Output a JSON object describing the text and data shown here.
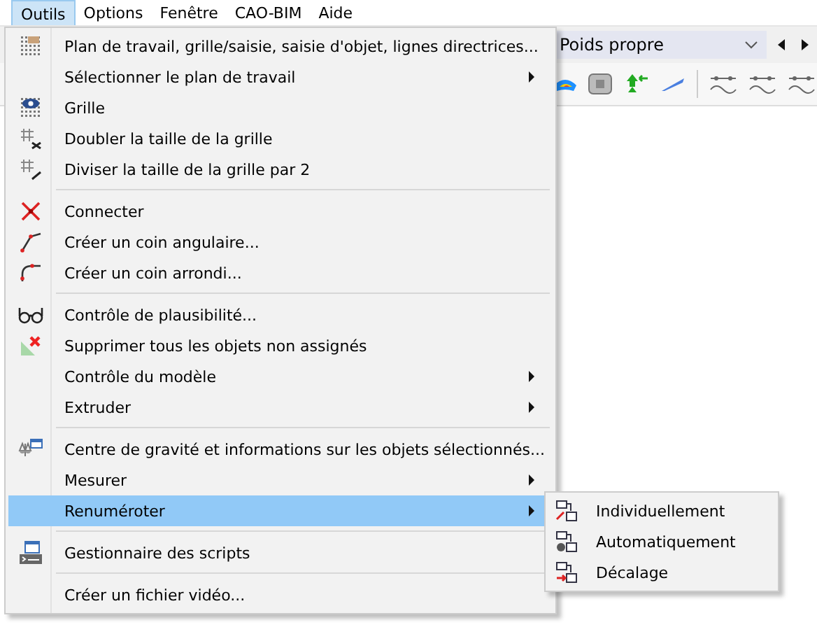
{
  "menubar": [
    {
      "label": "Outils",
      "selected": true
    },
    {
      "label": "Options",
      "selected": false
    },
    {
      "label": "Fenêtre",
      "selected": false
    },
    {
      "label": "CAO-BIM",
      "selected": false
    },
    {
      "label": "Aide",
      "selected": false
    }
  ],
  "load_case": {
    "value": "Poids propre"
  },
  "menu": {
    "items": [
      {
        "kind": "item",
        "label": "Plan de travail, grille/saisie, saisie d'objet, lignes directrices...",
        "submenu": false,
        "selected": false
      },
      {
        "kind": "item",
        "label": "Sélectionner le plan de travail",
        "submenu": true,
        "selected": false
      },
      {
        "kind": "item",
        "label": "Grille",
        "submenu": false,
        "selected": false
      },
      {
        "kind": "item",
        "label": "Doubler la taille de la grille",
        "submenu": false,
        "selected": false
      },
      {
        "kind": "item",
        "label": "Diviser la taille de la grille par 2",
        "submenu": false,
        "selected": false
      },
      {
        "kind": "separator"
      },
      {
        "kind": "item",
        "label": "Connecter",
        "submenu": false,
        "selected": false
      },
      {
        "kind": "item",
        "label": "Créer un coin angulaire...",
        "submenu": false,
        "selected": false
      },
      {
        "kind": "item",
        "label": "Créer un coin arrondi...",
        "submenu": false,
        "selected": false
      },
      {
        "kind": "separator"
      },
      {
        "kind": "item",
        "label": "Contrôle de plausibilité...",
        "submenu": false,
        "selected": false
      },
      {
        "kind": "item",
        "label": "Supprimer tous les objets non assignés",
        "submenu": false,
        "selected": false
      },
      {
        "kind": "item",
        "label": "Contrôle du modèle",
        "submenu": true,
        "selected": false
      },
      {
        "kind": "item",
        "label": "Extruder",
        "submenu": true,
        "selected": false
      },
      {
        "kind": "separator"
      },
      {
        "kind": "item",
        "label": "Centre de gravité et informations sur les objets sélectionnés...",
        "submenu": false,
        "selected": false
      },
      {
        "kind": "item",
        "label": "Mesurer",
        "submenu": true,
        "selected": false
      },
      {
        "kind": "item",
        "label": "Renuméroter",
        "submenu": true,
        "selected": true
      },
      {
        "kind": "separator"
      },
      {
        "kind": "item",
        "label": "Gestionnaire des scripts",
        "submenu": false,
        "selected": false
      },
      {
        "kind": "separator"
      },
      {
        "kind": "item",
        "label": "Créer un fichier vidéo...",
        "submenu": false,
        "selected": false
      }
    ]
  },
  "submenu": {
    "items": [
      {
        "label": "Individuellement"
      },
      {
        "label": "Automatiquement"
      },
      {
        "label": "Décalage"
      }
    ]
  }
}
